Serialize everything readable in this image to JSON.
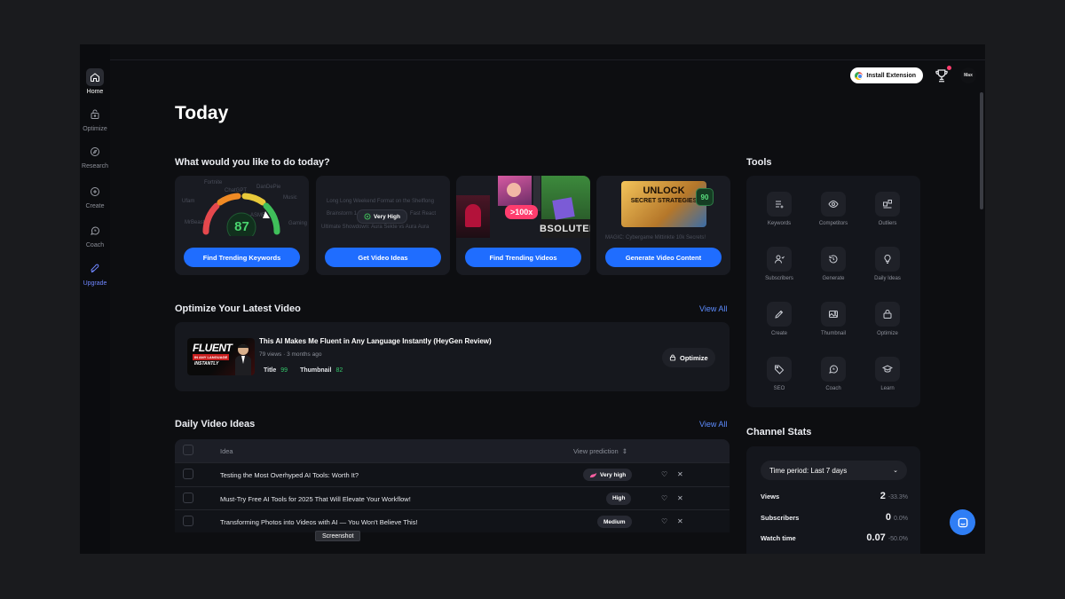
{
  "sidebar": {
    "items": [
      {
        "label": "Home",
        "icon": "home-icon"
      },
      {
        "label": "Optimize",
        "icon": "optimize-icon"
      },
      {
        "label": "Research",
        "icon": "compass-icon"
      },
      {
        "label": "Create",
        "icon": "plus-circle-icon"
      },
      {
        "label": "Coach",
        "icon": "chat-icon"
      },
      {
        "label": "Upgrade",
        "icon": "rocket-icon"
      }
    ]
  },
  "header": {
    "install_label": "Install Extension",
    "avatar_text": "Max"
  },
  "page_title": "Today",
  "today": {
    "title": "What would you like to do today?",
    "gauge_score": "87",
    "gauge_words": [
      "Fortnite",
      "ChatGPT",
      "DanDePie",
      "Music",
      "MrBeast",
      "ASMR",
      "Gaming",
      "Ufam"
    ],
    "idea_badge": "Very High",
    "idea_faint": [
      "Long Long Weekend Format on the Shelflong",
      "Brainstorm 1.5",
      "Fast React",
      "Ultimate Showdown: Aura Sekte vs Aura Aura"
    ],
    "trend_badge": ">100x",
    "trend_overlay": "BSOLUTEL",
    "gen_title_1": "UNLOCK",
    "gen_title_2": "SECRET STRATEGIES",
    "gen_score": "90",
    "gen_faint": "MAGIC: Cybergame Mittinkte 10k Secrets!",
    "cards": [
      {
        "button": "Find Trending Keywords"
      },
      {
        "button": "Get Video Ideas"
      },
      {
        "button": "Find Trending Videos"
      },
      {
        "button": "Generate Video Content"
      }
    ]
  },
  "optimize": {
    "title": "Optimize Your Latest Video",
    "view_all": "View All",
    "thumb_line1": "FLUENT",
    "thumb_line2": "IN ANY LANGUAGE",
    "thumb_line3": "INSTANTLY",
    "video_title": "This AI Makes Me Fluent in Any Language Instantly (HeyGen Review)",
    "meta": "79 views · 3 months ago",
    "title_label": "Title",
    "title_score": "99",
    "thumb_label": "Thumbnail",
    "thumb_score": "82",
    "button": "Optimize"
  },
  "ideas": {
    "title": "Daily Video Ideas",
    "view_all": "View All",
    "col_idea": "Idea",
    "col_prediction": "View prediction",
    "rows": [
      {
        "idea": "Testing the Most Overhyped AI Tools: Worth It?",
        "prediction": "Very high"
      },
      {
        "idea": "Must-Try Free AI Tools for 2025 That Will Elevate Your Workflow!",
        "prediction": "High"
      },
      {
        "idea": "Transforming Photos into Videos with AI — You Won't Believe This!",
        "prediction": "Medium"
      }
    ]
  },
  "tools": {
    "title": "Tools",
    "items": [
      {
        "label": "Keywords"
      },
      {
        "label": "Competitors"
      },
      {
        "label": "Outliers"
      },
      {
        "label": "Subscribers"
      },
      {
        "label": "Generate"
      },
      {
        "label": "Daily Ideas"
      },
      {
        "label": "Create"
      },
      {
        "label": "Thumbnail"
      },
      {
        "label": "Optimize"
      },
      {
        "label": "SEO"
      },
      {
        "label": "Coach"
      },
      {
        "label": "Learn"
      }
    ]
  },
  "stats": {
    "title": "Channel Stats",
    "period": "Time period: Last 7 days",
    "rows": [
      {
        "label": "Views",
        "value": "2",
        "pct": "-33.3%"
      },
      {
        "label": "Subscribers",
        "value": "0",
        "pct": "0.0%"
      },
      {
        "label": "Watch time",
        "value": "0.07",
        "pct": "-50.0%"
      }
    ]
  },
  "tooltip": "Screenshot",
  "colors": {
    "accent": "#1f6dff",
    "link": "#5d8cff",
    "positive": "#34c76b",
    "badge": "#ff3d6e"
  }
}
